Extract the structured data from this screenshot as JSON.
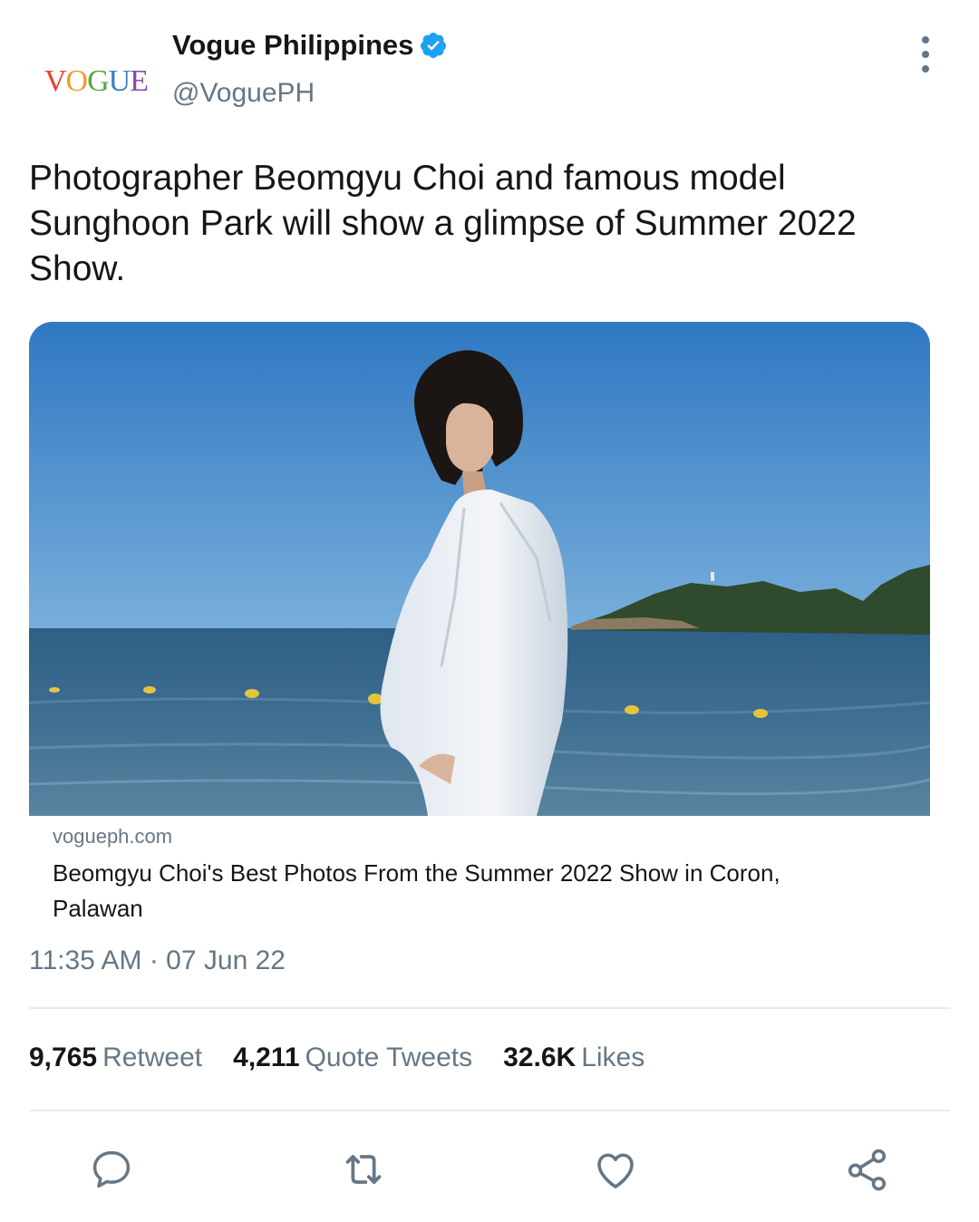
{
  "tweet": {
    "author": {
      "display_name": "Vogue Philippines",
      "handle": "@VoguePH",
      "verified": true,
      "avatar_logo": [
        "V",
        "O",
        "G",
        "U",
        "E"
      ],
      "avatar_logo_colors": [
        "#e8402f",
        "#f29b26",
        "#5aa544",
        "#3b7ec7",
        "#8c4aa8"
      ]
    },
    "text": "Photographer Beomgyu Choi and famous model Sunghoon Park will show a glimpse of Summer 2022 Show.",
    "card": {
      "domain": "vogueph.com",
      "title": "Beomgyu Choi's Best Photos From the Summer 2022 Show in Coron, Palawan"
    },
    "timestamp": "11:35 AM · 07 Jun 22",
    "stats": {
      "retweets": {
        "count": "9,765",
        "label": "Retweet"
      },
      "quotes": {
        "count": "4,211",
        "label": "Quote Tweets"
      },
      "likes": {
        "count": "32.6K",
        "label": "Likes"
      }
    },
    "actions": [
      "reply-icon",
      "retweet-icon",
      "like-icon",
      "share-icon"
    ],
    "colors": {
      "accent": "#1da1f2",
      "muted": "#657786",
      "text": "#14171a",
      "divider": "#e6ecf0"
    }
  }
}
